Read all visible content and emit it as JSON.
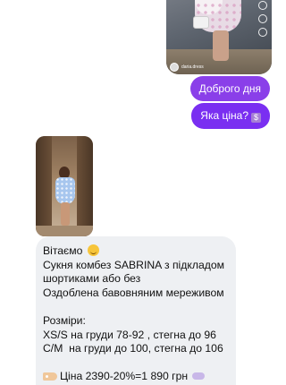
{
  "outgoing_media": {
    "account_name": "daria.dress"
  },
  "outgoing_messages": [
    {
      "text": "Доброго дня"
    },
    {
      "text": "Яка ціна?",
      "icon": "dollar-sign-icon"
    }
  ],
  "incoming_text": {
    "greeting": "Вітаємо",
    "lines": [
      "Сукня комбез SABRINA з підкладом",
      "шортиками або без",
      "Оздоблена бавовняним мереживом",
      "",
      "Розміри:",
      "XS/S на груди 78-92 , стегна до 96",
      "С/М  на груди до 100, стегна до 106",
      ""
    ],
    "price": "Ціна 2390-20%=1 890 грн"
  },
  "colors": {
    "outgoing_bubble": "#7a2ff1",
    "incoming_bubble": "#eef0f3"
  }
}
